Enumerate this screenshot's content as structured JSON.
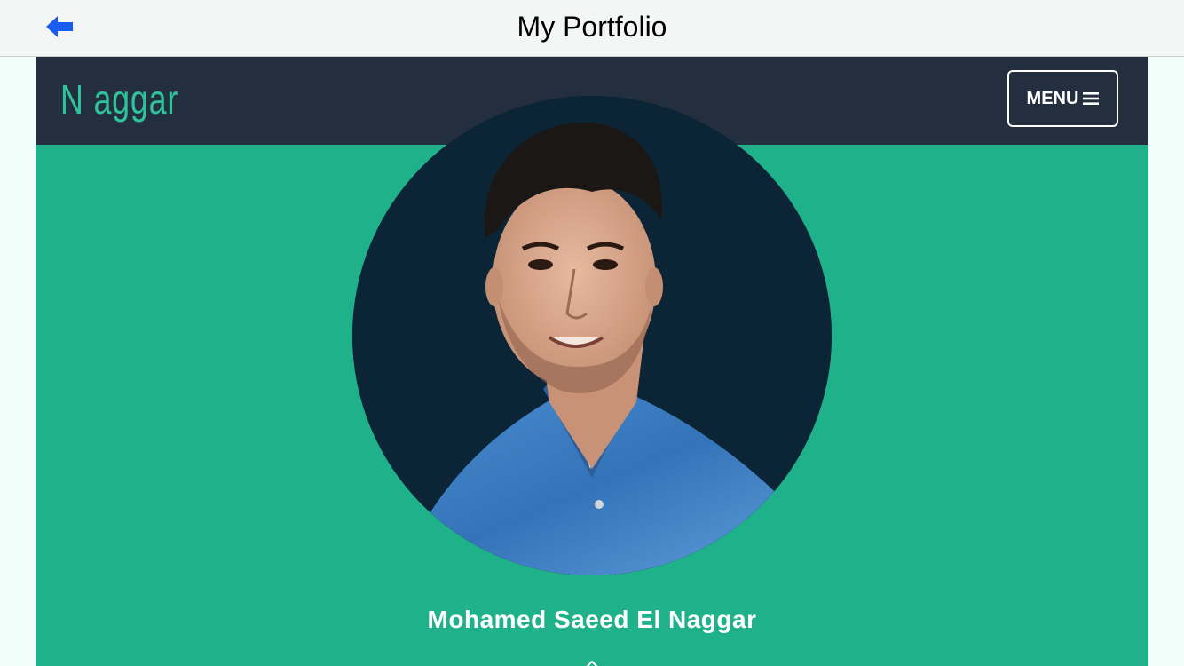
{
  "topbar": {
    "back_icon": "arrow-left-icon",
    "title": "My Portfolio",
    "accent": "#1a5cf0"
  },
  "navbar": {
    "brand": "N aggar",
    "menu_label": "MENU",
    "menu_icon": "hamburger-icon"
  },
  "hero": {
    "avatar_alt": "profile photo",
    "name": "Mohamed Saeed El Naggar"
  },
  "colors": {
    "topbar_bg": "#f4f6f6",
    "navbar_bg": "#232f3e",
    "brand": "#2ec39a",
    "hero_bg": "#1fb28a",
    "avatar_bg": "#0b2436",
    "shirt": "#3a7fc2"
  }
}
